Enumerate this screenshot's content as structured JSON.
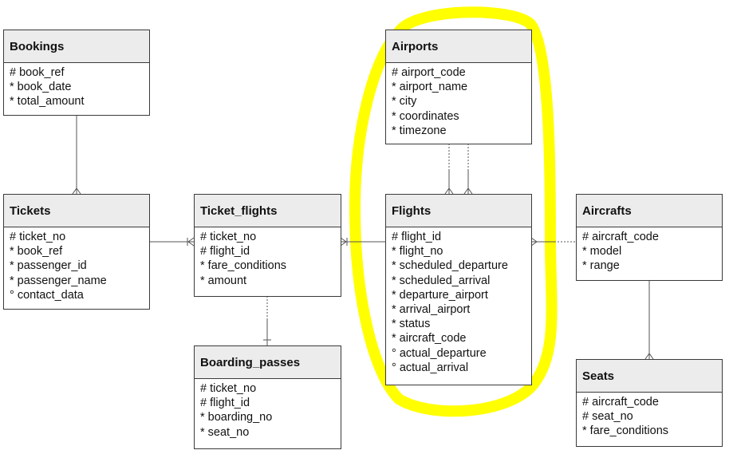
{
  "diagram": {
    "type": "entity-relationship",
    "highlight": {
      "color": "#ffff00",
      "encloses": [
        "Airports",
        "Flights"
      ]
    },
    "entities": [
      {
        "id": "bookings",
        "title": "Bookings",
        "attributes": [
          "# book_ref",
          "* book_date",
          "* total_amount"
        ]
      },
      {
        "id": "tickets",
        "title": "Tickets",
        "attributes": [
          "# ticket_no",
          "* book_ref",
          "* passenger_id",
          "* passenger_name",
          "° contact_data"
        ]
      },
      {
        "id": "ticket_flights",
        "title": "Ticket_flights",
        "attributes": [
          "# ticket_no",
          "# flight_id",
          "* fare_conditions",
          "* amount"
        ]
      },
      {
        "id": "boarding_passes",
        "title": "Boarding_passes",
        "attributes": [
          "# ticket_no",
          "# flight_id",
          "* boarding_no",
          "* seat_no"
        ]
      },
      {
        "id": "airports",
        "title": "Airports",
        "attributes": [
          "# airport_code",
          "* airport_name",
          "* city",
          "* coordinates",
          "* timezone"
        ]
      },
      {
        "id": "flights",
        "title": "Flights",
        "attributes": [
          "# flight_id",
          "* flight_no",
          "* scheduled_departure",
          "* scheduled_arrival",
          "* departure_airport",
          "* arrival_airport",
          "* status",
          "* aircraft_code",
          "° actual_departure",
          "° actual_arrival"
        ]
      },
      {
        "id": "aircrafts",
        "title": "Aircrafts",
        "attributes": [
          "# aircraft_code",
          "* model",
          "* range"
        ]
      },
      {
        "id": "seats",
        "title": "Seats",
        "attributes": [
          "# aircraft_code",
          "# seat_no",
          "* fare_conditions"
        ]
      }
    ],
    "relationships": [
      {
        "from": "bookings",
        "to": "tickets",
        "cardinality": "one-to-many",
        "style": "solid"
      },
      {
        "from": "tickets",
        "to": "ticket_flights",
        "cardinality": "one-to-one-or-many",
        "style": "solid"
      },
      {
        "from": "flights",
        "to": "ticket_flights",
        "cardinality": "one-to-one-or-many",
        "style": "solid"
      },
      {
        "from": "ticket_flights",
        "to": "boarding_passes",
        "cardinality": "one-to-one",
        "style": "dotted-solid"
      },
      {
        "from": "airports",
        "to": "flights",
        "cardinality": "one-to-many",
        "style": "dotted-solid",
        "role": "departure_airport"
      },
      {
        "from": "airports",
        "to": "flights",
        "cardinality": "one-to-many",
        "style": "dotted-solid",
        "role": "arrival_airport"
      },
      {
        "from": "aircrafts",
        "to": "flights",
        "cardinality": "one-to-many",
        "style": "dotted-solid"
      },
      {
        "from": "aircrafts",
        "to": "seats",
        "cardinality": "one-to-many",
        "style": "solid"
      }
    ]
  }
}
